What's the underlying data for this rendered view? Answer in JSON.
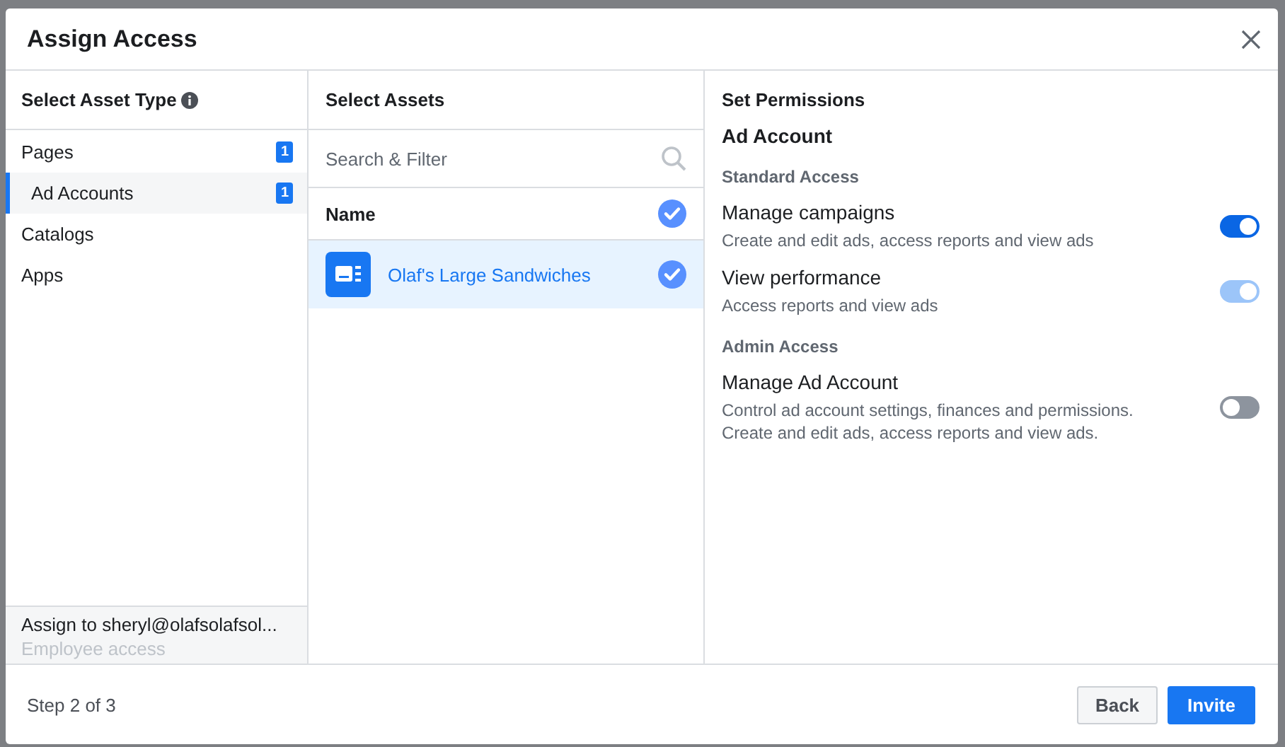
{
  "dialog": {
    "title": "Assign Access"
  },
  "asset_types": {
    "heading": "Select Asset Type",
    "items": [
      {
        "label": "Pages",
        "count": "1",
        "selected": false
      },
      {
        "label": "Ad Accounts",
        "count": "1",
        "selected": true
      },
      {
        "label": "Catalogs",
        "selected": false
      },
      {
        "label": "Apps",
        "selected": false
      }
    ],
    "assignee": "Assign to sheryl@olafsolafsol...",
    "access_level": "Employee access"
  },
  "assets": {
    "heading": "Select Assets",
    "search": {
      "placeholder": "Search & Filter"
    },
    "column": "Name",
    "all_checked": true,
    "rows": [
      {
        "name": "Olaf's Large Sandwiches",
        "selected": true
      }
    ]
  },
  "permissions": {
    "heading": "Set Permissions",
    "asset": "Ad Account",
    "groups": [
      {
        "title": "Standard Access",
        "items": [
          {
            "name": "Manage campaigns",
            "description": "Create and edit ads, access reports and view ads",
            "on": true,
            "disabled": false
          },
          {
            "name": "View performance",
            "description": "Access reports and view ads",
            "on": true,
            "disabled": true
          }
        ]
      },
      {
        "title": "Admin Access",
        "items": [
          {
            "name": "Manage Ad Account",
            "description": "Control ad account settings, finances and permissions. Create and edit ads, access reports and view ads.",
            "on": false,
            "disabled": false
          }
        ]
      }
    ]
  },
  "footer": {
    "step": "Step 2 of 3",
    "buttons": [
      {
        "label": "Back",
        "kind": "secondary"
      },
      {
        "label": "Invite",
        "kind": "primary"
      }
    ]
  }
}
